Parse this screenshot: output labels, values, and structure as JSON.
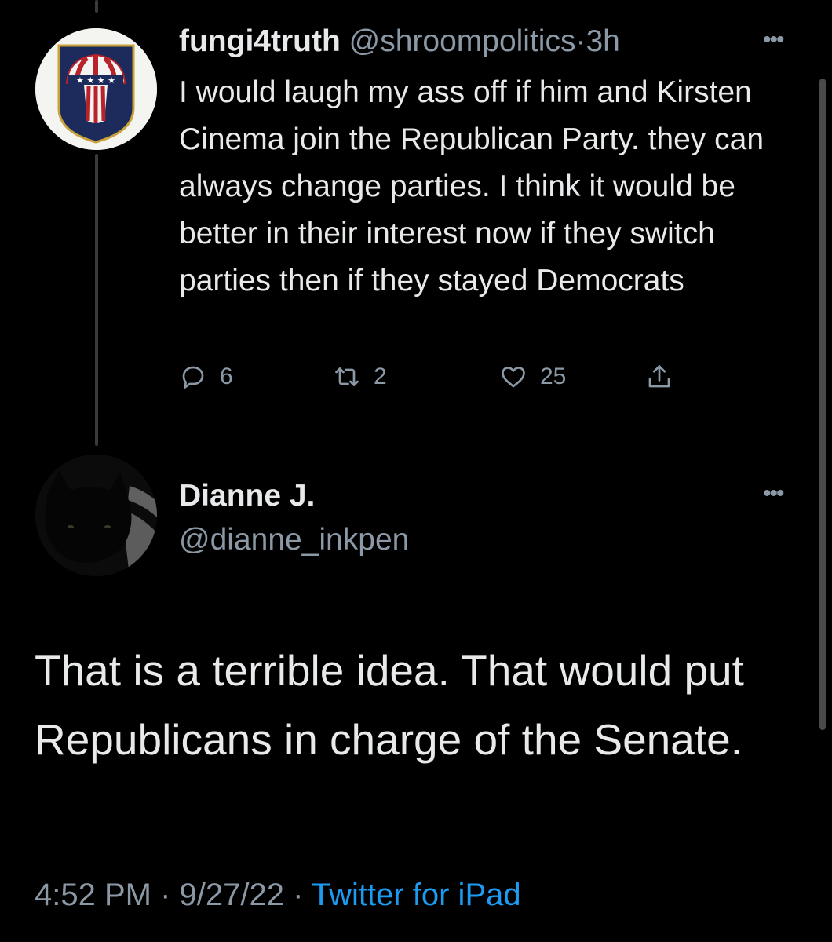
{
  "tweet1": {
    "display_name": "fungi4truth",
    "handle": "@shroompolitics",
    "separator": "·",
    "time": "3h",
    "more_label": "•••",
    "text": "I would laugh my ass off if him and Kirsten Cinema join the Republican Party. they can always change parties. I think it would be better in their interest now if they switch parties then if they stayed Democrats",
    "replies": "6",
    "retweets": "2",
    "likes": "25"
  },
  "tweet2": {
    "display_name": "Dianne J.",
    "handle": "@dianne_inkpen",
    "more_label": "•••",
    "text": "That is a terrible idea. That would put Republicans in charge of the Senate.",
    "time": "4:52 PM",
    "sep1": "·",
    "date": "9/27/22",
    "sep2": "·",
    "source": "Twitter for iPad"
  },
  "icons": {
    "avatar1": "mushroom-flag-avatar",
    "avatar2": "black-cat-avatar",
    "reply": "reply-icon",
    "retweet": "retweet-icon",
    "like": "heart-icon",
    "share": "share-icon"
  },
  "colors": {
    "background": "#000000",
    "text": "#e7e9ea",
    "muted": "#8b98a5",
    "link": "#1d9bf0"
  }
}
